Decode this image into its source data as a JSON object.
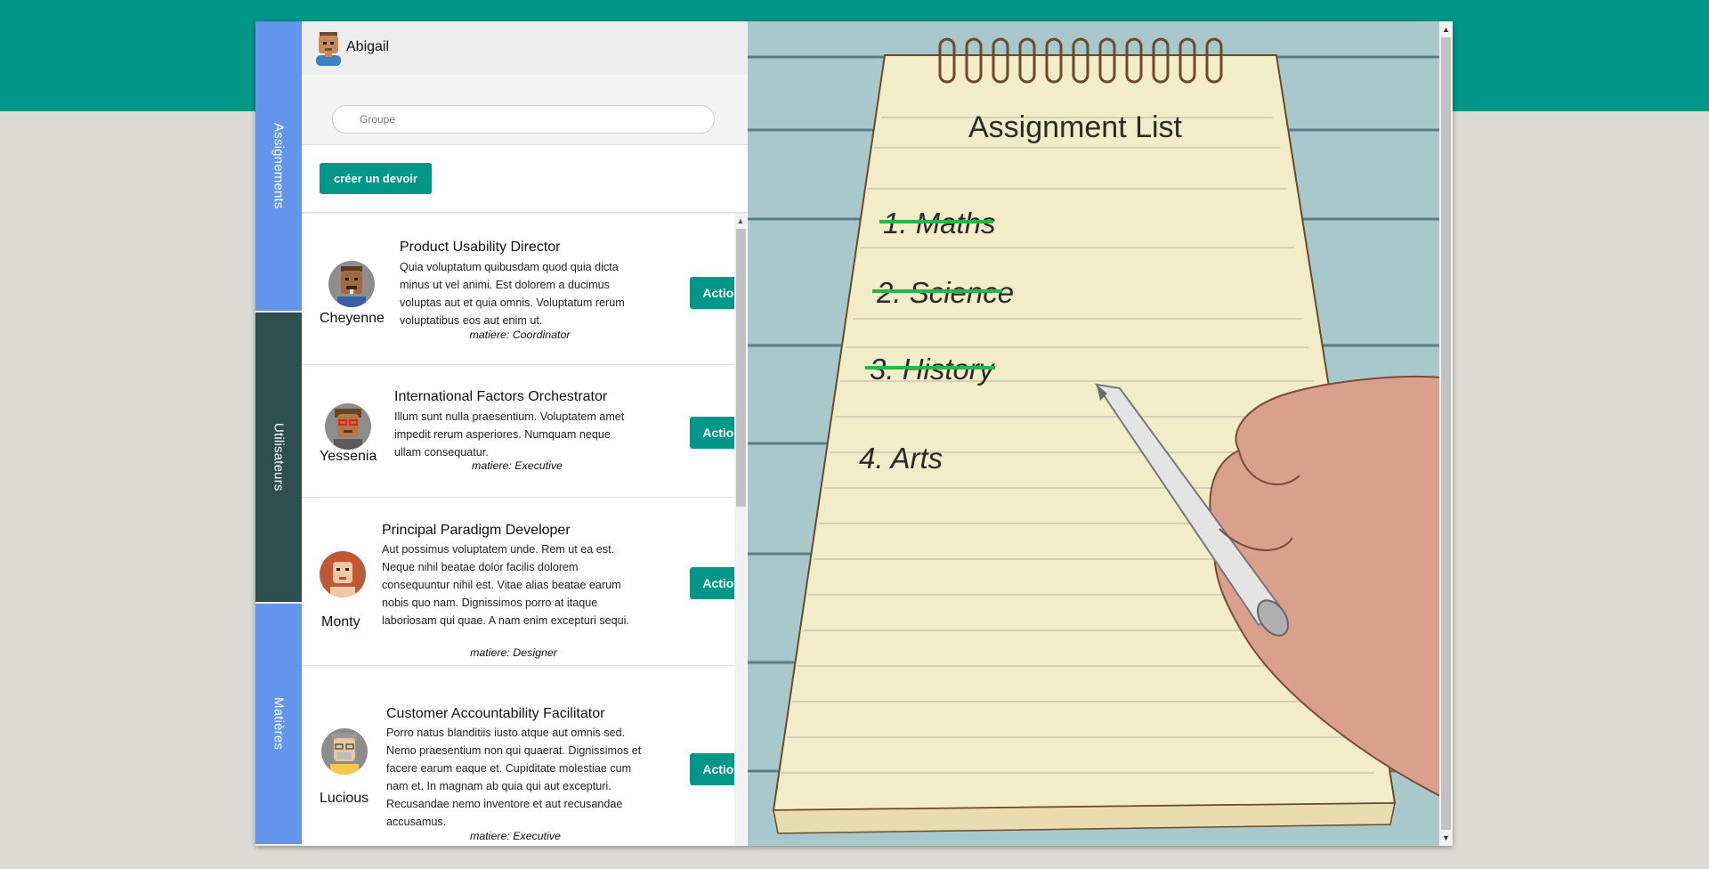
{
  "header": {
    "user_name": "Abigail"
  },
  "nav": {
    "tabs": [
      {
        "label": "Assignements",
        "active": false
      },
      {
        "label": "Utilisateurs",
        "active": true
      },
      {
        "label": "Matières",
        "active": false
      }
    ]
  },
  "search": {
    "placeholder": "Groupe"
  },
  "create_button": "créer un devoir",
  "assignments": [
    {
      "user": "Cheyenne",
      "title": "Product Usability Director",
      "description": "Quia voluptatum quibusdam quod quia dicta minus ut vel animi. Est dolorem a ducimus voluptas aut et quia omnis. Voluptatum rerum voluptatibus eos aut enim ut.",
      "matiere": "matiere: Coordinator",
      "action_label": "Actions"
    },
    {
      "user": "Yessenia",
      "title": "International Factors Orchestrator",
      "description": "Illum sunt nulla praesentium. Voluptatem amet impedit rerum asperiores. Numquam neque ullam consequatur.",
      "matiere": "matiere: Executive",
      "action_label": "Actions"
    },
    {
      "user": "Monty",
      "title": "Principal Paradigm Developer",
      "description": "Aut possimus voluptatem unde. Rem ut ea est. Neque nihil beatae dolor facilis dolorem consequuntur nihil est. Vitae alias beatae earum nobis quo nam. Dignissimos porro at itaque laboriosam qui quae. A nam enim excepturi sequi.",
      "matiere": "matiere: Designer",
      "action_label": "Actions"
    },
    {
      "user": "Lucious",
      "title": "Customer Accountability Facilitator",
      "description": "Porro natus blanditiis iusto atque aut omnis sed. Nemo praesentium non qui quaerat. Dignissimos et facere earum eaque et. Cupiditate molestiae cum nam et. In magnam ab quia qui aut excepturi. Recusandae nemo inventore et aut recusandae accusamus.",
      "matiere": "matiere: Executive",
      "action_label": "Actions"
    }
  ],
  "illustration": {
    "heading": "Assignment List",
    "items": [
      {
        "text": "1.  Maths",
        "done": true
      },
      {
        "text": "2.  Science",
        "done": true
      },
      {
        "text": "3.  History",
        "done": true
      },
      {
        "text": "4.  Arts",
        "done": false
      }
    ]
  },
  "colors": {
    "accent": "#009688",
    "nav_tab": "#6495ed",
    "nav_tab_active": "#2f4f4f",
    "strike": "#2db34a"
  }
}
